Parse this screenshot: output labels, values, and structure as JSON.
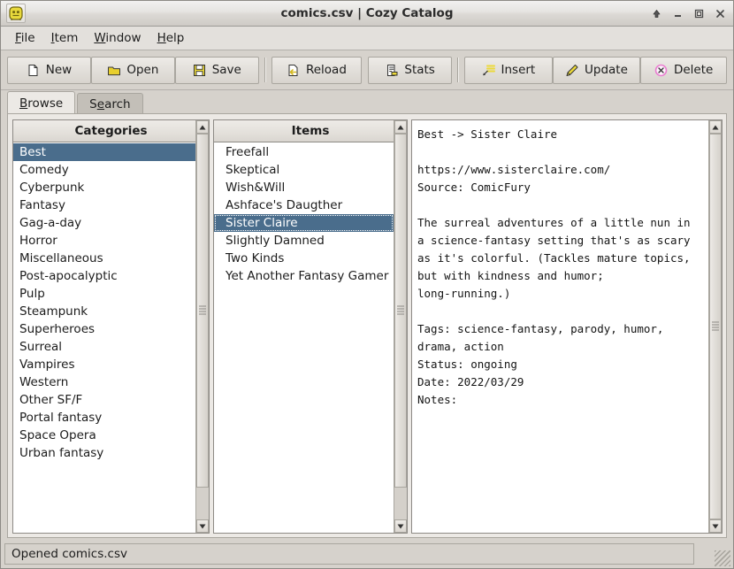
{
  "window": {
    "title": "comics.csv | Cozy Catalog",
    "app_icon": "cozy-catalog-icon",
    "controls": [
      {
        "name": "shade-button",
        "icon": "up-arrow-icon"
      },
      {
        "name": "minimize-button",
        "icon": "minimize-icon"
      },
      {
        "name": "maximize-button",
        "icon": "maximize-icon"
      },
      {
        "name": "close-button",
        "icon": "close-icon"
      }
    ]
  },
  "menubar": {
    "items": [
      {
        "mnemonic": "F",
        "rest": "ile"
      },
      {
        "mnemonic": "I",
        "rest": "tem"
      },
      {
        "mnemonic": "W",
        "rest": "indow"
      },
      {
        "mnemonic": "H",
        "rest": "elp"
      }
    ]
  },
  "toolbar": {
    "buttons": [
      {
        "label": "New",
        "icon": "new-document-icon"
      },
      {
        "label": "Open",
        "icon": "open-folder-icon"
      },
      {
        "label": "Save",
        "icon": "floppy-disk-icon"
      },
      {
        "label": "Reload",
        "icon": "reload-icon"
      },
      {
        "label": "Stats",
        "icon": "stats-icon"
      },
      {
        "label": "Insert",
        "icon": "insert-icon"
      },
      {
        "label": "Update",
        "icon": "pencil-icon"
      },
      {
        "label": "Delete",
        "icon": "delete-circle-icon"
      }
    ],
    "separator_after": [
      2,
      4
    ]
  },
  "tabs": [
    {
      "mnemonic": "B",
      "rest": "rowse",
      "label": "Browse",
      "active": true
    },
    {
      "mnemonic": "e",
      "rest": "arch",
      "label": "Search",
      "active": false
    }
  ],
  "categories": {
    "header": "Categories",
    "items": [
      "Best",
      "Comedy",
      "Cyberpunk",
      "Fantasy",
      "Gag-a-day",
      "Horror",
      "Miscellaneous",
      "Post-apocalyptic",
      "Pulp",
      "Steampunk",
      "Superheroes",
      "Surreal",
      "Vampires",
      "Western",
      "Other SF/F",
      "Portal fantasy",
      "Space Opera",
      "Urban fantasy"
    ],
    "selected_index": 0
  },
  "items": {
    "header": "Items",
    "items": [
      "Freefall",
      "Skeptical",
      "Wish&Will",
      "Ashface's Daugther",
      "Sister Claire",
      "Slightly Damned",
      "Two Kinds",
      "Yet Another Fantasy Gamer"
    ],
    "selected_index": 4
  },
  "detail": {
    "text": "Best -> Sister Claire\n\nhttps://www.sisterclaire.com/\nSource: ComicFury\n\nThe surreal adventures of a little nun in\na science-fantasy setting that's as scary\nas it's colorful. (Tackles mature topics,\nbut with kindness and humor;\nlong-running.)\n\nTags: science-fantasy, parody, humor,\ndrama, action\nStatus: ongoing\nDate: 2022/03/29\nNotes:"
  },
  "statusbar": {
    "text": "Opened comics.csv"
  },
  "colors": {
    "selection": "#4a6d8c",
    "window_bg": "#d6d2cc",
    "panel_bg": "#ece9e5",
    "list_bg": "#ffffff",
    "border": "#8d8a85"
  }
}
